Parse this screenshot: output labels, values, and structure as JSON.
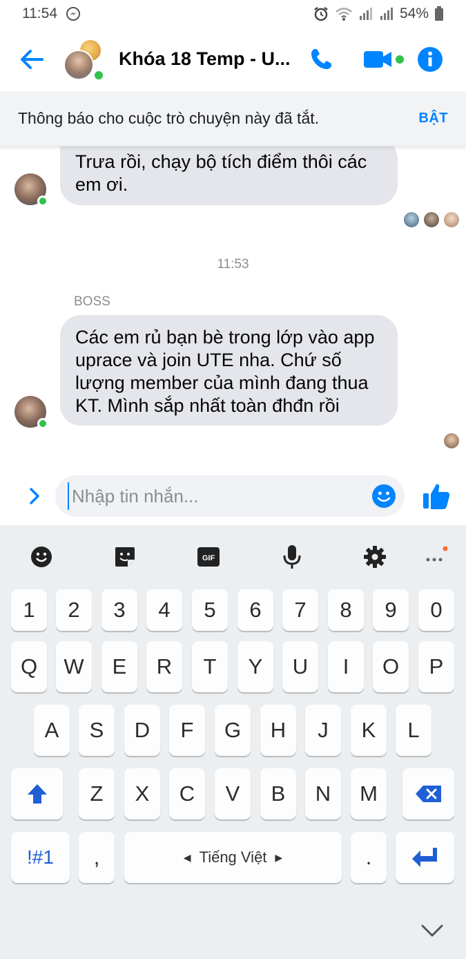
{
  "status_bar": {
    "time": "11:54",
    "battery": "54%"
  },
  "header": {
    "title": "Khóa 18 Temp - U..."
  },
  "notification": {
    "text": "Thông báo cho cuộc trò chuyện này đã tắt.",
    "button": "BẬT"
  },
  "messages": [
    {
      "text_line1": "Trưa rồi, chạy bộ tích điểm thôi các",
      "text_line2": "em ơi."
    },
    {
      "lines": [
        "Các em rủ bạn bè trong lớp vào app",
        "uprace và join UTE nha. Chứ số",
        "lượng member của mình đang thua",
        "KT. Mình sắp nhất toàn đhđn rồi"
      ]
    }
  ],
  "timestamp": "11:53",
  "sender": "BOSS",
  "composer": {
    "placeholder": "Nhập tin nhắn..."
  },
  "keyboard": {
    "row_numbers": [
      "1",
      "2",
      "3",
      "4",
      "5",
      "6",
      "7",
      "8",
      "9",
      "0"
    ],
    "row_q": [
      "Q",
      "W",
      "E",
      "R",
      "T",
      "Y",
      "U",
      "I",
      "O",
      "P"
    ],
    "row_a": [
      "A",
      "S",
      "D",
      "F",
      "G",
      "H",
      "J",
      "K",
      "L"
    ],
    "row_z": [
      "Z",
      "X",
      "C",
      "V",
      "B",
      "N",
      "M"
    ],
    "symbols": "!#1",
    "comma": ",",
    "space": "Tiếng Việt",
    "period": "."
  },
  "colors": {
    "accent": "#0084ff",
    "online": "#31c24d",
    "bubble": "#e4e6eb"
  }
}
